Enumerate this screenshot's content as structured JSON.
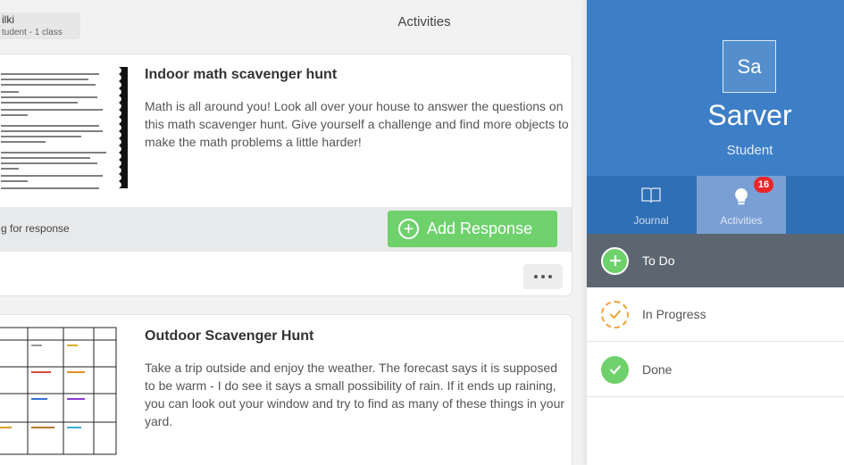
{
  "header": {
    "user_name": "ilki",
    "user_subtitle": "tudent - 1 class",
    "title": "Activities"
  },
  "activities": [
    {
      "title": "Indoor math scavenger hunt",
      "description": "Math is all around you!  Look all over your house to answer the questions on this math scavenger hunt.  Give yourself a challenge and find more objects to make the math problems a little harder!",
      "thumbnail": "math-worksheet-image",
      "status": "g for response",
      "add_response_label": "Add Response"
    },
    {
      "title": "Outdoor Scavenger Hunt",
      "description": "Take a trip outside and enjoy the weather.  The forecast says it is supposed to be warm - I do see it says a small possibility of rain.  If it ends up raining, you can look out your window and try to find as many of these things in your yard.",
      "thumbnail": "scavenger-grid-image"
    }
  ],
  "profile": {
    "initials": "Sa",
    "name": "Sarver",
    "role": "Student"
  },
  "tabs": [
    {
      "label": "Journal",
      "icon": "book-icon"
    },
    {
      "label": "Activities",
      "icon": "lightbulb-icon",
      "badge": "16"
    }
  ],
  "statuses": [
    {
      "label": "To Do",
      "icon": "plus-circle-icon"
    },
    {
      "label": "In Progress",
      "icon": "progress-check-icon"
    },
    {
      "label": "Done",
      "icon": "check-circle-icon"
    }
  ],
  "colors": {
    "profile_blue": "#3d7fc7",
    "tab_blue": "#2f6fb5",
    "active_tab": "#7a9fd4",
    "green": "#6ed16c",
    "orange": "#f0a33b",
    "badge_red": "#e8262b",
    "todo_bg": "#5c6670"
  }
}
